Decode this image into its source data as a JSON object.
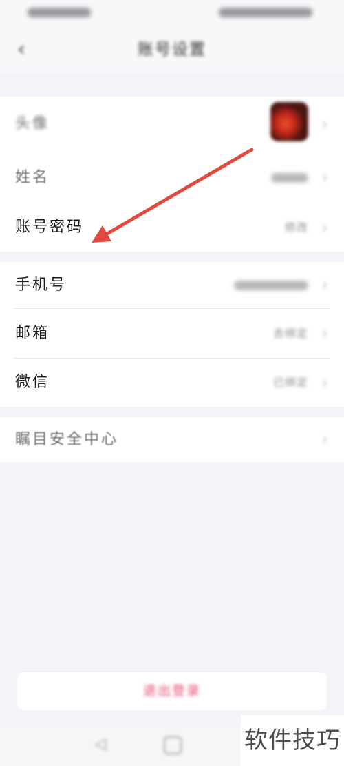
{
  "header": {
    "title": "账号设置",
    "back_icon": "chevron-left-icon"
  },
  "profile": {
    "avatar_label": "头像",
    "name_label": "姓名",
    "password_label": "账号密码",
    "password_value": "修改"
  },
  "contact": {
    "phone_label": "手机号",
    "email_label": "邮箱",
    "email_value": "去绑定",
    "wechat_label": "微信",
    "wechat_value": "已绑定"
  },
  "security": {
    "label": "瞩目安全中心"
  },
  "logout": {
    "label": "退出登录"
  },
  "watermark": "软件技巧",
  "icons": {
    "back": "chevron-left-icon",
    "row_chevron": "chevron-right-icon",
    "annotation": "red-arrow-icon",
    "nav_back": "nav-back-icon",
    "nav_home": "nav-home-icon"
  },
  "colors": {
    "annotation_arrow": "#e04a3f",
    "logout_text": "#e4476a",
    "page_background": "#f3f4f7"
  }
}
